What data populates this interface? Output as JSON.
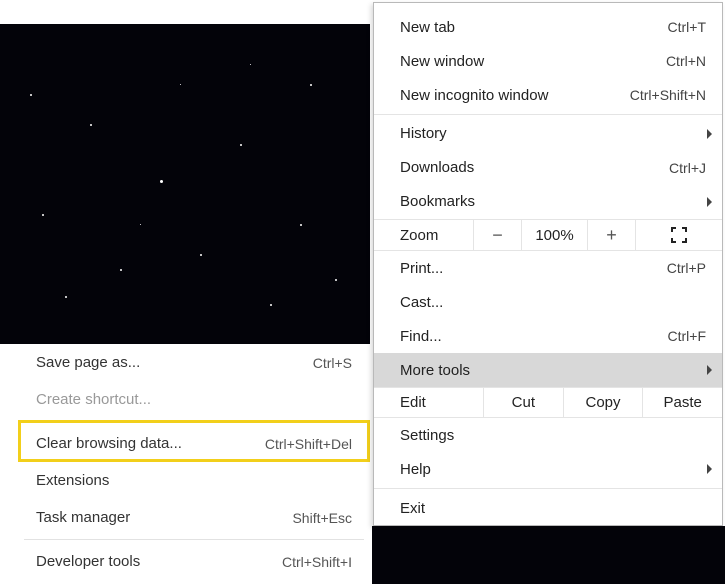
{
  "main_menu": {
    "new_tab": {
      "label": "New tab",
      "shortcut": "Ctrl+T"
    },
    "new_window": {
      "label": "New window",
      "shortcut": "Ctrl+N"
    },
    "new_incognito": {
      "label": "New incognito window",
      "shortcut": "Ctrl+Shift+N"
    },
    "history": {
      "label": "History"
    },
    "downloads": {
      "label": "Downloads",
      "shortcut": "Ctrl+J"
    },
    "bookmarks": {
      "label": "Bookmarks"
    },
    "zoom": {
      "label": "Zoom",
      "minus": "−",
      "value": "100%",
      "plus": "+"
    },
    "print": {
      "label": "Print...",
      "shortcut": "Ctrl+P"
    },
    "cast": {
      "label": "Cast..."
    },
    "find": {
      "label": "Find...",
      "shortcut": "Ctrl+F"
    },
    "more_tools": {
      "label": "More tools"
    },
    "edit": {
      "label": "Edit",
      "cut": "Cut",
      "copy": "Copy",
      "paste": "Paste"
    },
    "settings": {
      "label": "Settings"
    },
    "help": {
      "label": "Help"
    },
    "exit": {
      "label": "Exit"
    }
  },
  "submenu": {
    "save_page": {
      "label": "Save page as...",
      "shortcut": "Ctrl+S"
    },
    "create_shortcut": {
      "label": "Create shortcut..."
    },
    "clear_browsing": {
      "label": "Clear browsing data...",
      "shortcut": "Ctrl+Shift+Del"
    },
    "extensions": {
      "label": "Extensions"
    },
    "task_manager": {
      "label": "Task manager",
      "shortcut": "Shift+Esc"
    },
    "developer_tools": {
      "label": "Developer tools",
      "shortcut": "Ctrl+Shift+I"
    }
  }
}
